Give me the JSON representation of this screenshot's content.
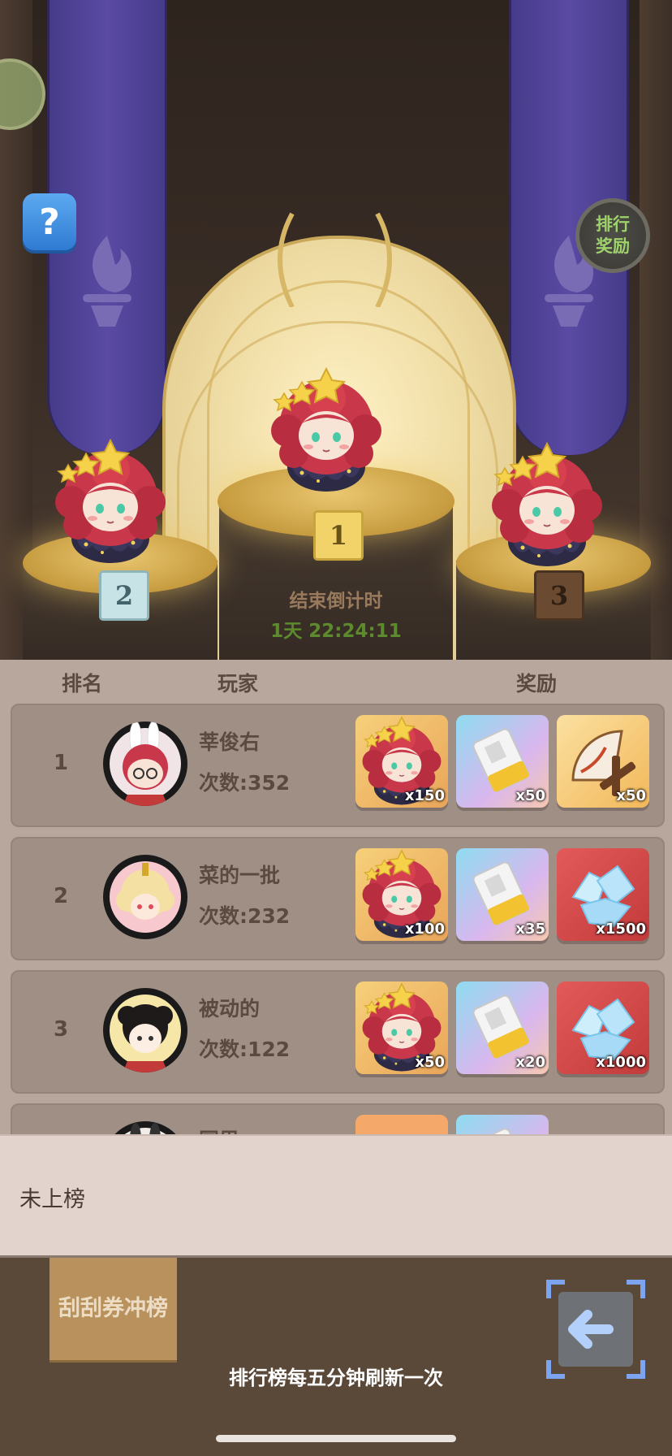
{
  "podium": {
    "countdown_label": "结束倒计时",
    "countdown_value": "1天 22:24:11",
    "ranks": [
      "1",
      "2",
      "3"
    ]
  },
  "buttons": {
    "help_label": "?",
    "reward_label_line1": "排行",
    "reward_label_line2": "奖励",
    "scratch_label": "刮刮券冲榜"
  },
  "table": {
    "headers": {
      "rank": "排名",
      "player": "玩家",
      "reward": "奖励"
    },
    "rows": [
      {
        "rank": "1",
        "name": "莘俊右",
        "score": "次数:352",
        "rewards": [
          {
            "icon": "character-icon",
            "qty": "x150"
          },
          {
            "icon": "scratch-ticket-icon",
            "qty": "x50"
          },
          {
            "icon": "fan-icon",
            "qty": "x50"
          }
        ]
      },
      {
        "rank": "2",
        "name": "菜的一批",
        "score": "次数:232",
        "rewards": [
          {
            "icon": "character-icon",
            "qty": "x100"
          },
          {
            "icon": "scratch-ticket-icon",
            "qty": "x35"
          },
          {
            "icon": "diamond-icon",
            "qty": "x1500"
          }
        ]
      },
      {
        "rank": "3",
        "name": "被动的",
        "score": "次数:122",
        "rewards": [
          {
            "icon": "character-icon",
            "qty": "x50"
          },
          {
            "icon": "scratch-ticket-icon",
            "qty": "x20"
          },
          {
            "icon": "diamond-icon",
            "qty": "x1000"
          }
        ]
      },
      {
        "rank": "",
        "name": "国男",
        "score": "",
        "rewards": [
          {
            "icon": "bow-icon",
            "qty": ""
          },
          {
            "icon": "scratch-ticket-icon",
            "qty": ""
          }
        ]
      }
    ]
  },
  "not_ranked": "未上榜",
  "refresh_note": "排行榜每五分钟刷新一次",
  "colors": {
    "banner": "#5a4aa3",
    "countdown_green": "#5c8a2c",
    "reward_green": "#9ed36b",
    "help_blue": "#2f7bd3"
  }
}
